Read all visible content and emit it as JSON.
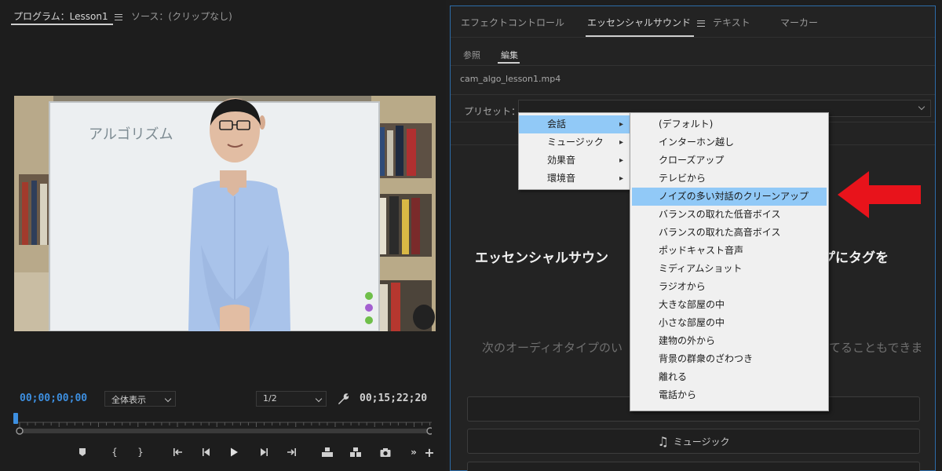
{
  "program_monitor": {
    "tab_program": "プログラム：Lesson1",
    "tab_source": "ソース：(クリップなし)",
    "timecode_current": "00;00;00;00",
    "timecode_duration": "00;15;22;20",
    "zoom_label": "全体表示",
    "resolution_label": "1/2",
    "whiteboard_text": "アルゴリズム",
    "transport_icons": [
      "marker-icon",
      "mark-in-icon",
      "mark-out-icon",
      "go-to-in-icon",
      "step-back-icon",
      "play-icon",
      "step-forward-icon",
      "go-to-out-icon",
      "lift-icon",
      "extract-icon",
      "export-frame-icon",
      "more-icon",
      "add-icon"
    ]
  },
  "essential_sound": {
    "tabs": [
      "エフェクトコントロール",
      "エッセンシャルサウンド",
      "テキスト",
      "マーカー"
    ],
    "active_tab": "エッセンシャルサウンド",
    "subtabs": [
      "参照",
      "編集"
    ],
    "active_subtab": "編集",
    "clip_name": "cam_algo_lesson1.mp4",
    "preset_label": "プリセット：",
    "heading_left": "エッセンシャルサウン",
    "heading_right": "ップにタグを",
    "subtext_left": "次のオーディオタイプのい",
    "subtext_right": "てることもできま",
    "music_button_label": "ミュージック",
    "accent_color": "#2d6ca8"
  },
  "category_menu": {
    "items": [
      {
        "label": "会話",
        "highlighted": true
      },
      {
        "label": "ミュージック",
        "highlighted": false
      },
      {
        "label": "効果音",
        "highlighted": false
      },
      {
        "label": "環境音",
        "highlighted": false
      }
    ]
  },
  "preset_menu": {
    "items": [
      {
        "label": "(デフォルト)"
      },
      {
        "label": "インターホン越し"
      },
      {
        "label": "クローズアップ"
      },
      {
        "label": "テレビから"
      },
      {
        "label": "ノイズの多い対話のクリーンアップ",
        "highlighted": true
      },
      {
        "label": "バランスの取れた低音ボイス"
      },
      {
        "label": "バランスの取れた高音ボイス"
      },
      {
        "label": "ポッドキャスト音声"
      },
      {
        "label": "ミディアムショット"
      },
      {
        "label": "ラジオから"
      },
      {
        "label": "大きな部屋の中"
      },
      {
        "label": "小さな部屋の中"
      },
      {
        "label": "建物の外から"
      },
      {
        "label": "背景の群衆のざわつき"
      },
      {
        "label": "離れる"
      },
      {
        "label": "電話から"
      }
    ],
    "highlight_color": "#91c9f7"
  },
  "annotation": {
    "arrow_color": "#e8131b"
  }
}
